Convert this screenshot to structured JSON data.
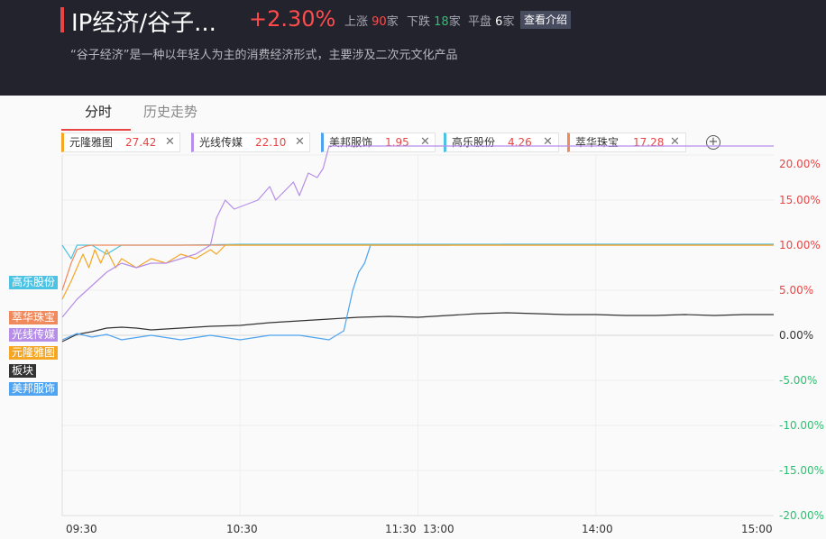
{
  "header": {
    "title": "IP经济/谷子...",
    "change": "+2.30%",
    "up_label": "上涨",
    "up_count": "90",
    "up_unit": "家",
    "down_label": "下跌",
    "down_count": "18",
    "down_unit": "家",
    "flat_label": "平盘",
    "flat_count": "6",
    "flat_unit": "家",
    "intro_button": "查看介绍",
    "description": "“谷子经济”是一种以年轻人为主的消费经济形式，主要涉及二次元文化产品"
  },
  "tabs": [
    {
      "label": "分时",
      "active": true
    },
    {
      "label": "历史走势",
      "active": false
    }
  ],
  "stocks": [
    {
      "name": "元隆雅图",
      "value": "27.42",
      "color": "#f5a623"
    },
    {
      "name": "光线传媒",
      "value": "22.10",
      "color": "#b68ee8"
    },
    {
      "name": "美邦服饰",
      "value": "1.95",
      "color": "#4ea4f0"
    },
    {
      "name": "高乐股份",
      "value": "4.26",
      "color": "#4dc3e3"
    },
    {
      "name": "萃华珠宝",
      "value": "17.28",
      "color": "#f08a5d"
    }
  ],
  "add_icon": "plus-circle-icon",
  "close_icon": "close-icon",
  "series_labels": [
    {
      "name": "高乐股份",
      "color": "#4dc3e3"
    },
    {
      "name": "萃华珠宝",
      "color": "#f08a5d"
    },
    {
      "name": "光线传媒",
      "color": "#b68ee8"
    },
    {
      "name": "元隆雅图",
      "color": "#f5a623"
    },
    {
      "name": "板块",
      "color": "#333333"
    },
    {
      "name": "美邦服饰",
      "color": "#4ea4f0"
    }
  ],
  "chart_data": {
    "type": "line",
    "x_ticks": [
      "09:30",
      "10:30",
      "11:30",
      "13:00",
      "14:00",
      "15:00"
    ],
    "y_ticks": [
      "20.00%",
      "15.00%",
      "10.00%",
      "5.00%",
      "0.00%",
      "-5.00%",
      "-10.00%",
      "-15.00%",
      "-20.00%"
    ],
    "ylim": [
      -20,
      20
    ],
    "grid": true,
    "series": [
      {
        "name": "板块",
        "color": "#333333",
        "points": [
          [
            0,
            -0.7
          ],
          [
            5,
            0.1
          ],
          [
            10,
            0.4
          ],
          [
            15,
            0.8
          ],
          [
            20,
            0.9
          ],
          [
            25,
            0.8
          ],
          [
            30,
            0.6
          ],
          [
            40,
            0.8
          ],
          [
            50,
            1.0
          ],
          [
            60,
            1.1
          ],
          [
            70,
            1.4
          ],
          [
            80,
            1.6
          ],
          [
            90,
            1.8
          ],
          [
            100,
            2.0
          ],
          [
            110,
            2.1
          ],
          [
            120,
            2.0
          ],
          [
            130,
            2.2
          ],
          [
            140,
            2.4
          ],
          [
            150,
            2.5
          ],
          [
            160,
            2.4
          ],
          [
            170,
            2.3
          ],
          [
            180,
            2.3
          ],
          [
            190,
            2.2
          ],
          [
            200,
            2.2
          ],
          [
            210,
            2.3
          ],
          [
            220,
            2.2
          ],
          [
            230,
            2.3
          ],
          [
            240,
            2.3
          ]
        ]
      },
      {
        "name": "美邦服饰",
        "color": "#4ea4f0",
        "points": [
          [
            0,
            -0.5
          ],
          [
            5,
            0.2
          ],
          [
            10,
            -0.2
          ],
          [
            15,
            0.1
          ],
          [
            20,
            -0.5
          ],
          [
            30,
            0
          ],
          [
            40,
            -0.5
          ],
          [
            50,
            0
          ],
          [
            60,
            -0.5
          ],
          [
            70,
            0
          ],
          [
            80,
            0
          ],
          [
            90,
            -0.5
          ],
          [
            95,
            0.5
          ],
          [
            98,
            5.0
          ],
          [
            100,
            7.0
          ],
          [
            102,
            8.0
          ],
          [
            104,
            10.0
          ],
          [
            110,
            10.0
          ],
          [
            120,
            10.0
          ],
          [
            130,
            10.0
          ],
          [
            150,
            10.1
          ],
          [
            180,
            10.1
          ],
          [
            210,
            10.1
          ],
          [
            240,
            10.1
          ]
        ]
      },
      {
        "name": "高乐股份",
        "color": "#4dc3e3",
        "points": [
          [
            0,
            10.0
          ],
          [
            3,
            8.5
          ],
          [
            5,
            10.0
          ],
          [
            10,
            10.0
          ],
          [
            15,
            9.0
          ],
          [
            20,
            10.0
          ],
          [
            30,
            10.0
          ],
          [
            40,
            10.0
          ],
          [
            60,
            10.1
          ],
          [
            100,
            10.1
          ],
          [
            150,
            10.1
          ],
          [
            200,
            10.1
          ],
          [
            240,
            10.1
          ]
        ]
      },
      {
        "name": "萃华珠宝",
        "color": "#f08a5d",
        "points": [
          [
            0,
            5.0
          ],
          [
            3,
            8.0
          ],
          [
            5,
            9.5
          ],
          [
            8,
            9.9
          ],
          [
            10,
            10.0
          ],
          [
            20,
            10.0
          ],
          [
            40,
            10.0
          ],
          [
            60,
            10.0
          ],
          [
            100,
            10.0
          ],
          [
            150,
            10.0
          ],
          [
            200,
            10.0
          ],
          [
            240,
            10.0
          ]
        ]
      },
      {
        "name": "元隆雅图",
        "color": "#f5a623",
        "points": [
          [
            0,
            4.0
          ],
          [
            3,
            6.0
          ],
          [
            5,
            7.5
          ],
          [
            7,
            9.0
          ],
          [
            9,
            7.5
          ],
          [
            11,
            9.5
          ],
          [
            13,
            8.0
          ],
          [
            15,
            9.5
          ],
          [
            18,
            7.5
          ],
          [
            20,
            8.5
          ],
          [
            25,
            7.5
          ],
          [
            30,
            8.5
          ],
          [
            35,
            8.0
          ],
          [
            40,
            9.0
          ],
          [
            45,
            8.5
          ],
          [
            50,
            9.5
          ],
          [
            52,
            9.0
          ],
          [
            55,
            10.0
          ],
          [
            60,
            10.0
          ],
          [
            80,
            10.0
          ],
          [
            120,
            10.0
          ],
          [
            160,
            10.0
          ],
          [
            200,
            10.0
          ],
          [
            240,
            10.0
          ]
        ]
      },
      {
        "name": "光线传媒",
        "color": "#b68ee8",
        "points": [
          [
            0,
            2.0
          ],
          [
            5,
            4.0
          ],
          [
            10,
            5.5
          ],
          [
            15,
            7.0
          ],
          [
            20,
            8.0
          ],
          [
            25,
            7.5
          ],
          [
            30,
            8.0
          ],
          [
            35,
            8.0
          ],
          [
            40,
            8.5
          ],
          [
            45,
            9.0
          ],
          [
            50,
            10.0
          ],
          [
            52,
            13.0
          ],
          [
            55,
            15.0
          ],
          [
            58,
            14.0
          ],
          [
            62,
            14.5
          ],
          [
            66,
            15.0
          ],
          [
            70,
            16.5
          ],
          [
            72,
            15.0
          ],
          [
            75,
            16.0
          ],
          [
            78,
            17.0
          ],
          [
            80,
            15.5
          ],
          [
            83,
            18.0
          ],
          [
            86,
            17.5
          ],
          [
            88,
            18.5
          ],
          [
            90,
            21.0
          ],
          [
            100,
            21.0
          ],
          [
            150,
            21.0
          ],
          [
            200,
            21.0
          ],
          [
            240,
            21.0
          ]
        ]
      }
    ]
  }
}
